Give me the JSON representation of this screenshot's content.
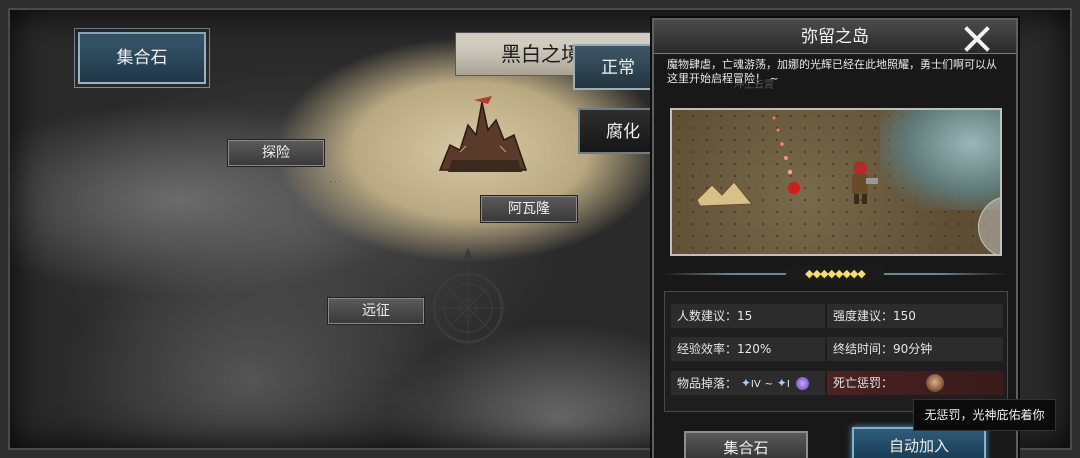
{
  "map": {
    "gather_stone_label": "集合石",
    "banner_title": "黑白之境",
    "modes": [
      "正常",
      "腐化"
    ],
    "nodes": [
      "探险",
      "阿瓦隆",
      "远征"
    ],
    "faded_label_1": "冲上云霄",
    "faded_label_2": "弥留之岛"
  },
  "panel": {
    "title": "弥留之岛",
    "description": "魔物肆虐，亡魂游荡，加娜的光辉已经在此地照耀，勇士们啊可以从这里开始启程冒险！ ~",
    "stars": "◆◆◆◆◆◆◆◆",
    "info": {
      "players_label": "人数建议：",
      "players_value": "15",
      "strength_label": "强度建议：",
      "strength_value": "150",
      "exp_label": "经验效率：",
      "exp_value": "120%",
      "end_label": "终结时间：",
      "end_value": "90分钟",
      "drop_label": "物品掉落：",
      "drop_from": "IV",
      "drop_sep": "~",
      "drop_to": "I",
      "death_label": "死亡惩罚："
    },
    "btn_gather": "集合石",
    "btn_auto": "自动加入"
  },
  "tooltip": "无惩罚，光神庇佑着你",
  "colors": {
    "accent": "#7fb2cf",
    "star": "#f4e15a",
    "penalty_bg": "#4a2222"
  }
}
